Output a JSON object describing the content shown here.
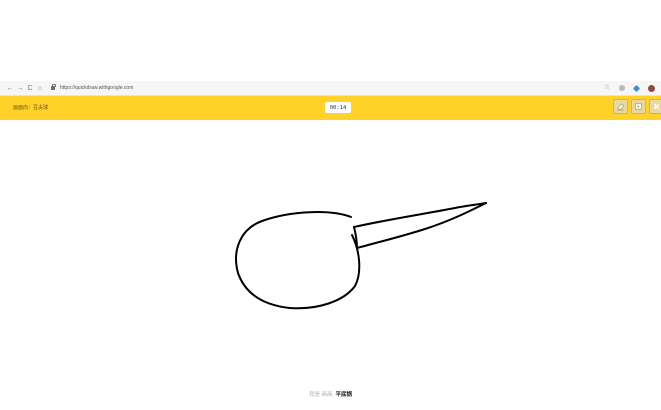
{
  "browser": {
    "back_icon": "←",
    "forward_icon": "→",
    "reload_icon": "C",
    "home_icon": "⌂",
    "url": "https://quickdraw.withgoogle.com",
    "star_icon": "☆"
  },
  "game": {
    "prompt": "画面向：豆夫球",
    "timer": "00:14"
  },
  "guess": {
    "prefix": "我是 画画,",
    "answer": "平底锅"
  },
  "colors": {
    "header_bg": "#ffd129",
    "ink": "#000000"
  }
}
